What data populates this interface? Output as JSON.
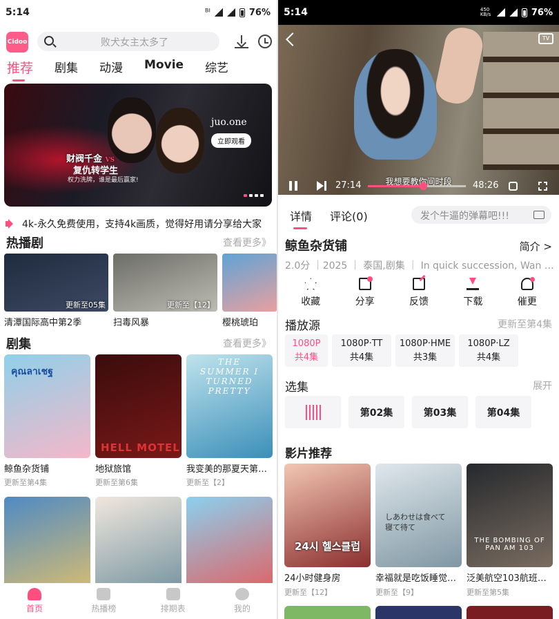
{
  "left": {
    "status": {
      "time": "5:14",
      "network": "ᴮᴵ",
      "battery": "76%"
    },
    "logo_text": "Cidoo",
    "search": {
      "placeholder": "败犬女主太多了"
    },
    "tabs": [
      "推荐",
      "剧集",
      "动漫",
      "Movie",
      "综艺"
    ],
    "banner": {
      "title_line1": "财阀千金",
      "vs": "VS",
      "title_line2": "复仇转学生",
      "tagline": "权力洗牌，谁是最后赢家!",
      "brand": "juo.one",
      "watch_button": "立即观看"
    },
    "notice": "4k-永久免费使用，支持4k画质，觉得好用请分享给大家",
    "hot": {
      "title": "热播剧",
      "more": "查看更多》",
      "items": [
        {
          "title": "清潭国际高中第2季",
          "badge": "更新至05集",
          "colors": [
            "#1f2b3e",
            "#3c4a63"
          ]
        },
        {
          "title": "扫毒风暴",
          "badge": "更新至【12】",
          "colors": [
            "#6d6d68",
            "#bdbcb3"
          ]
        },
        {
          "title": "樱桃琥珀",
          "badge": "",
          "colors": [
            "#5fa3d6",
            "#e9a0a0"
          ]
        }
      ]
    },
    "series": {
      "title": "剧集",
      "more": "查看更多》",
      "items": [
        {
          "title": "鲸鱼杂货铺",
          "sub": "更新至第4集",
          "colors": [
            "#8fd0e9",
            "#f5b7c9"
          ]
        },
        {
          "title": "地狱旅馆",
          "sub": "更新至第6集",
          "colors": [
            "#3a0c0c",
            "#7a1818"
          ]
        },
        {
          "title": "我变美的那夏天第…",
          "sub": "更新至【2】",
          "colors": [
            "#bfe3ec",
            "#3b8fb9"
          ]
        },
        {
          "title": "",
          "sub": "",
          "colors": [
            "#4f8ac4",
            "#e0c06c"
          ]
        },
        {
          "title": "",
          "sub": "",
          "colors": [
            "#f0e7dd",
            "#6d8e9c"
          ]
        },
        {
          "title": "",
          "sub": "",
          "colors": [
            "#8bd0ef",
            "#e65a5a"
          ]
        }
      ]
    },
    "poster_texts": {
      "s1": "คุณลาเชฐ",
      "s2": "HELL MOTEL",
      "s3": "THE SUMMER I TURNED PRETTY"
    },
    "nav": [
      {
        "label": "首页",
        "icon": "home-icon"
      },
      {
        "label": "热播榜",
        "icon": "chart-icon"
      },
      {
        "label": "排期表",
        "icon": "calendar-icon"
      },
      {
        "label": "我的",
        "icon": "profile-icon"
      }
    ]
  },
  "right": {
    "status": {
      "time": "5:14",
      "speed": "450 KB/s",
      "battery": "76%"
    },
    "player": {
      "subtitle": "我想要教你间时段",
      "current": "27:14",
      "duration": "48:26",
      "progress": 0.5625,
      "tv_label": "TV"
    },
    "tabs": [
      "详情",
      "评论(0)"
    ],
    "danmu_placeholder": "发个牛逼的弹幕吧!!!",
    "title": "鲸鱼杂货铺",
    "intro_label": "简介 >",
    "meta": "2.0分  ｜2025  ｜  泰国,剧集  ｜  In quick succession, Wan l...",
    "actions": [
      {
        "label": "收藏",
        "icon": "star-icon",
        "cls": "ic-star"
      },
      {
        "label": "分享",
        "icon": "share-icon",
        "cls": "ic-share"
      },
      {
        "label": "反馈",
        "icon": "feedback-icon",
        "cls": "ic-edit"
      },
      {
        "label": "下载",
        "icon": "download-icon",
        "cls": "ic-down"
      },
      {
        "label": "催更",
        "icon": "bell-icon",
        "cls": "ic-bell"
      }
    ],
    "sources": {
      "title": "播放源",
      "status": "更新至第4集",
      "items": [
        {
          "name": "1080P",
          "count": "共4集"
        },
        {
          "name": "1080P·TT",
          "count": "共4集"
        },
        {
          "name": "1080P·HME",
          "count": "共3集"
        },
        {
          "name": "1080P·LZ",
          "count": "共4集"
        }
      ]
    },
    "episodes": {
      "title": "选集",
      "expand": "展开",
      "items": [
        "",
        "第02集",
        "第03集",
        "第04集"
      ]
    },
    "recommend": {
      "title": "影片推荐",
      "items": [
        {
          "title": "24小时健身房",
          "sub": "更新至【12】",
          "colors": [
            "#f2c7b3",
            "#8b2f2f"
          ],
          "poster": "24시 헬스클럽"
        },
        {
          "title": "幸福就是吃饭睡觉…",
          "sub": "更新至【9】",
          "colors": [
            "#dfe7ec",
            "#7f97a3"
          ],
          "poster": "しあわせは食べて寝て待て"
        },
        {
          "title": "泛美航空103航班…",
          "sub": "更新至第5集",
          "colors": [
            "#25292d",
            "#7a6c60"
          ],
          "poster": "THE BOMBING OF PAN AM 103"
        }
      ]
    }
  }
}
